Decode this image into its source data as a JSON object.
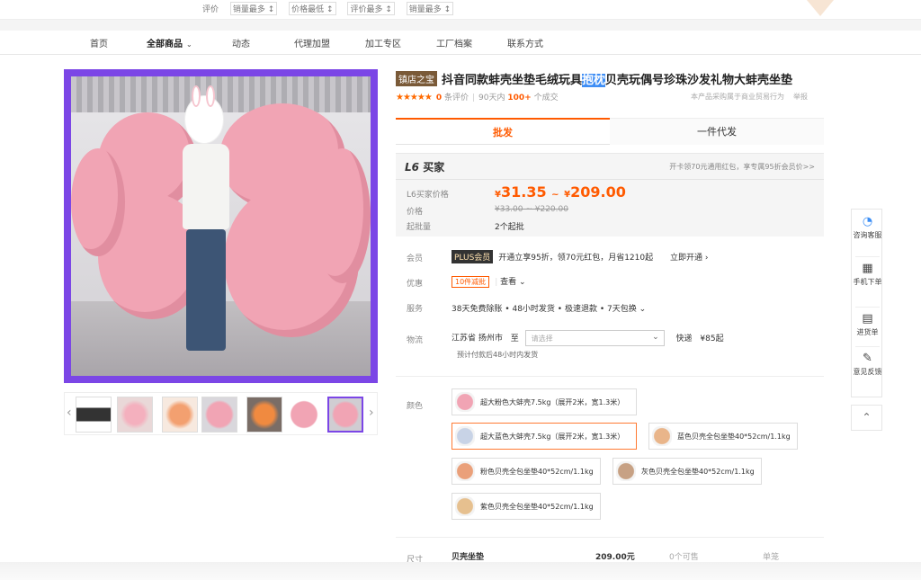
{
  "topbar": {
    "crumbs": [
      "评价",
      "销量最多 ↕",
      "价格最低 ↕",
      "评价最多 ↕",
      "销量最多 ↕"
    ]
  },
  "nav": {
    "items": [
      "首页",
      "全部商品",
      "动态",
      "代理加盟",
      "加工专区",
      "工厂档案",
      "联系方式"
    ],
    "chevron": "⌄"
  },
  "product": {
    "badge": "镇店之宝",
    "title_pre": "抖音同款蚌壳坐垫毛绒玩具",
    "title_highlight": "抱枕",
    "title_post": "贝壳玩偶号珍珠沙发礼物大蚌壳坐垫",
    "stars": "★★★★★",
    "review_count": "0",
    "review_label": "条评价",
    "sales_prefix": "90天内",
    "sales_count": "100+",
    "sales_suffix": "个成交",
    "protection_text": "本产品采购属于商业贸易行为",
    "report_label": "举报"
  },
  "tabs": {
    "wholesale": "批发",
    "dropship": "一件代发"
  },
  "pricing": {
    "level_label": "L6",
    "level_suffix": "买家",
    "level_promo": "开卡领70元通用红包，享专属95折会员价>>",
    "buyer_price_label": "L6买家价格",
    "currency": "¥",
    "price_low": "31.35",
    "range_sep": "~",
    "price_high": "209.00",
    "price_label": "价格",
    "old_price": "¥33.00 ~ ¥220.00",
    "moq_label": "起批量",
    "moq_value": "2个起批"
  },
  "member": {
    "label": "会员",
    "plus_badge": "PLUS会员",
    "text": "开通立享95折，领70元红包，月省1210起",
    "action": "立即开通 ›"
  },
  "discount": {
    "label": "优惠",
    "coupon": "10件减批",
    "action": "查看 ⌄"
  },
  "service": {
    "label": "服务",
    "text": "38天免费除账 • 48小时发货 • 极速退款 • 7天包换 ⌄"
  },
  "logistics": {
    "label": "物流",
    "origin": "江苏省 扬州市",
    "to": "至",
    "select_placeholder": "请选择",
    "express": "快递",
    "express_price": "¥85起",
    "note": "预计付款后48小时内发货"
  },
  "color": {
    "label": "颜色",
    "options": [
      "超大粉色大蚌壳7.5kg（展开2米，宽1.3米）",
      "超大蓝色大蚌壳7.5kg（展开2米，宽1.3米）",
      "蓝色贝壳全包坐垫40*52cm/1.1kg",
      "粉色贝壳全包坐垫40*52cm/1.1kg",
      "灰色贝壳全包坐垫40*52cm/1.1kg",
      "紫色贝壳全包坐垫40*52cm/1.1kg"
    ],
    "swatch_colors": [
      "#f1a4b4",
      "#c8d3e6",
      "#e9b58a",
      "#eaa07a",
      "#c7a184",
      "#e6c08f"
    ]
  },
  "size_row": {
    "label": "尺寸",
    "name": "贝壳坐垫",
    "price": "209.00元",
    "stock": "0个可售",
    "unit": "单笼"
  },
  "sidebar": {
    "items": [
      "咨询客服",
      "手机下单",
      "进货单",
      "意见反馈"
    ],
    "totop": "⌃"
  },
  "colors": {
    "accent": "#ff5a00",
    "purple": "#7b46e6"
  }
}
